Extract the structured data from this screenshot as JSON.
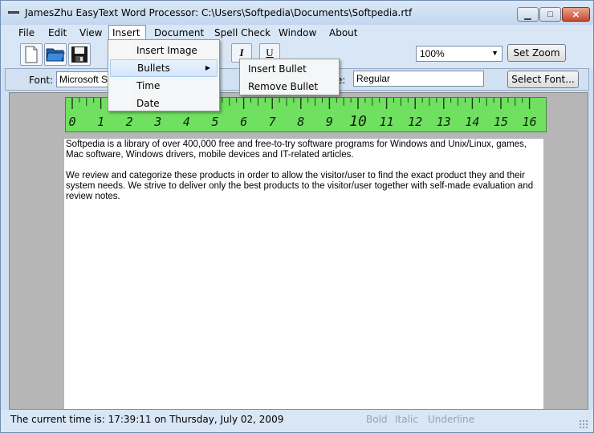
{
  "window": {
    "title": "JamesZhu EasyText Word Processor: C:\\Users\\Softpedia\\Documents\\Softpedia.rtf",
    "minimize_glyph": "▁",
    "maximize_glyph": "□",
    "close_glyph": "✕"
  },
  "menubar": {
    "items": [
      {
        "label": "File"
      },
      {
        "label": "Edit"
      },
      {
        "label": "View"
      },
      {
        "label": "Insert"
      },
      {
        "label": "Document"
      },
      {
        "label": "Spell Check"
      },
      {
        "label": "Window"
      },
      {
        "label": "About"
      }
    ]
  },
  "toolbar": {
    "icons": [
      "new-document-icon",
      "open-folder-icon",
      "save-disk-icon"
    ],
    "italic_label": "I",
    "underline_label": "U",
    "zoom_value": "100%",
    "zoom_button": "Set Zoom"
  },
  "fontbar": {
    "font_label": "Font:",
    "font_value": "Microsoft Sans Serif",
    "style_label_partial": "e:",
    "style_value": "Regular",
    "select_font_button": "Select Font..."
  },
  "insert_menu": {
    "items": [
      {
        "label": "Insert Image"
      },
      {
        "label": "Bullets",
        "has_submenu": true
      },
      {
        "label": "Time"
      },
      {
        "label": "Date"
      }
    ],
    "submenu_arrow": "▶"
  },
  "bullets_submenu": {
    "items": [
      {
        "label": "Insert Bullet"
      },
      {
        "label": "Remove Bullet"
      }
    ]
  },
  "ruler": {
    "numbers": [
      "0",
      "1",
      "2",
      "3",
      "4",
      "5",
      "6",
      "7",
      "8",
      "9",
      "10",
      "11",
      "12",
      "13",
      "14",
      "15",
      "16"
    ],
    "color": "#6fe05f"
  },
  "document": {
    "paragraphs": [
      "Softpedia is a library of over 400,000 free and free-to-try software programs for Windows and Unix/Linux, games, Mac software, Windows drivers, mobile devices and IT-related articles.",
      "We review and categorize these products in order to allow the visitor/user to find the exact product they and their system needs. We strive to deliver only the best products to the visitor/user together with self-made evaluation and review notes."
    ]
  },
  "statusbar": {
    "time_text": "The current time is: 17:39:11 on Thursday, July 02, 2009",
    "bold": "Bold",
    "italic": "Italic",
    "underline": "Underline"
  }
}
